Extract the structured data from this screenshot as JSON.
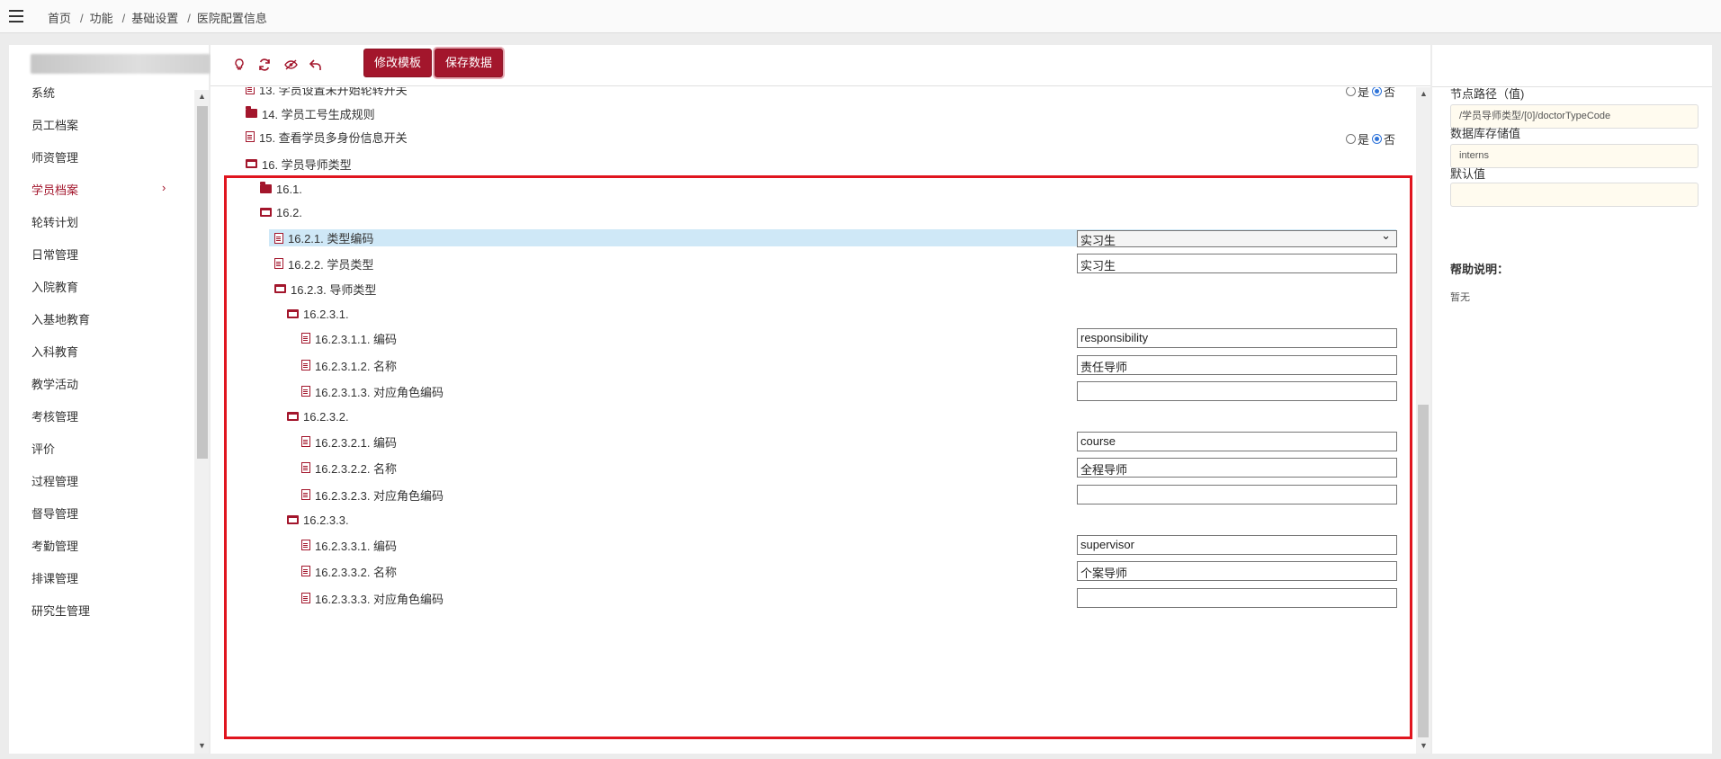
{
  "breadcrumb": [
    "首页",
    "功能",
    "基础设置",
    "医院配置信息"
  ],
  "sidebar": {
    "items": [
      {
        "label": "系统",
        "active": false
      },
      {
        "label": "员工档案",
        "active": false
      },
      {
        "label": "师资管理",
        "active": false
      },
      {
        "label": "学员档案",
        "active": true
      },
      {
        "label": "轮转计划",
        "active": false
      },
      {
        "label": "日常管理",
        "active": false
      },
      {
        "label": "入院教育",
        "active": false
      },
      {
        "label": "入基地教育",
        "active": false
      },
      {
        "label": "入科教育",
        "active": false
      },
      {
        "label": "教学活动",
        "active": false
      },
      {
        "label": "考核管理",
        "active": false
      },
      {
        "label": "评价",
        "active": false
      },
      {
        "label": "过程管理",
        "active": false
      },
      {
        "label": "督导管理",
        "active": false
      },
      {
        "label": "考勤管理",
        "active": false
      },
      {
        "label": "排课管理",
        "active": false
      },
      {
        "label": "研究生管理",
        "active": false
      }
    ]
  },
  "toolbar": {
    "icons": [
      "lightbulb-icon",
      "refresh-icon",
      "eye-off-icon",
      "undo-icon"
    ],
    "edit_template_label": "修改模板",
    "save_data_label": "保存数据"
  },
  "radio_labels": {
    "yes": "是",
    "no": "否"
  },
  "tree": [
    {
      "label": "13. 学员设置未开始轮转开关",
      "kind": "doc",
      "indent": 0,
      "control": "radio",
      "value": "no"
    },
    {
      "label": "14. 学员工号生成规则",
      "kind": "folder",
      "indent": 0
    },
    {
      "label": "15. 查看学员多身份信息开关",
      "kind": "doc",
      "indent": 0,
      "control": "radio",
      "value": "no"
    },
    {
      "label": "16. 学员导师类型",
      "kind": "folder-open",
      "indent": 0
    },
    {
      "label": "16.1.",
      "kind": "folder",
      "indent": 1
    },
    {
      "label": "16.2.",
      "kind": "folder-open",
      "indent": 1
    },
    {
      "label": "16.2.1. 类型编码",
      "kind": "doc",
      "indent": 2,
      "control": "select",
      "value": "实习生",
      "selected": true
    },
    {
      "label": "16.2.2. 学员类型",
      "kind": "doc",
      "indent": 2,
      "control": "input",
      "value": "实习生"
    },
    {
      "label": "16.2.3. 导师类型",
      "kind": "folder-open",
      "indent": 2
    },
    {
      "label": "16.2.3.1.",
      "kind": "folder-open",
      "indent": 3
    },
    {
      "label": "16.2.3.1.1. 编码",
      "kind": "doc",
      "indent": 4,
      "control": "input",
      "value": "responsibility"
    },
    {
      "label": "16.2.3.1.2. 名称",
      "kind": "doc",
      "indent": 4,
      "control": "input",
      "value": "责任导师"
    },
    {
      "label": "16.2.3.1.3. 对应角色编码",
      "kind": "doc",
      "indent": 4,
      "control": "input",
      "value": ""
    },
    {
      "label": "16.2.3.2.",
      "kind": "folder-open",
      "indent": 3
    },
    {
      "label": "16.2.3.2.1. 编码",
      "kind": "doc",
      "indent": 4,
      "control": "input",
      "value": "course"
    },
    {
      "label": "16.2.3.2.2. 名称",
      "kind": "doc",
      "indent": 4,
      "control": "input",
      "value": "全程导师"
    },
    {
      "label": "16.2.3.2.3. 对应角色编码",
      "kind": "doc",
      "indent": 4,
      "control": "input",
      "value": ""
    },
    {
      "label": "16.2.3.3.",
      "kind": "folder-open",
      "indent": 3
    },
    {
      "label": "16.2.3.3.1. 编码",
      "kind": "doc",
      "indent": 4,
      "control": "input",
      "value": "supervisor"
    },
    {
      "label": "16.2.3.3.2. 名称",
      "kind": "doc",
      "indent": 4,
      "control": "input",
      "value": "个案导师"
    },
    {
      "label": "16.2.3.3.3. 对应角色编码",
      "kind": "doc",
      "indent": 4,
      "control": "input",
      "value": ""
    }
  ],
  "right_panel": {
    "node_path_label": "节点路径（值)",
    "node_path_value": "/学员导师类型/[0]/doctorTypeCode",
    "db_value_label": "数据库存储值",
    "db_value": "interns",
    "default_label": "默认值",
    "default_value": "",
    "help_label": "帮助说明：",
    "help_text": "暂无"
  },
  "colors": {
    "accent": "#a3162c",
    "highlight_border": "#e0151f",
    "selected_row": "#cfe8f7",
    "input_bg": "#fffbef"
  }
}
